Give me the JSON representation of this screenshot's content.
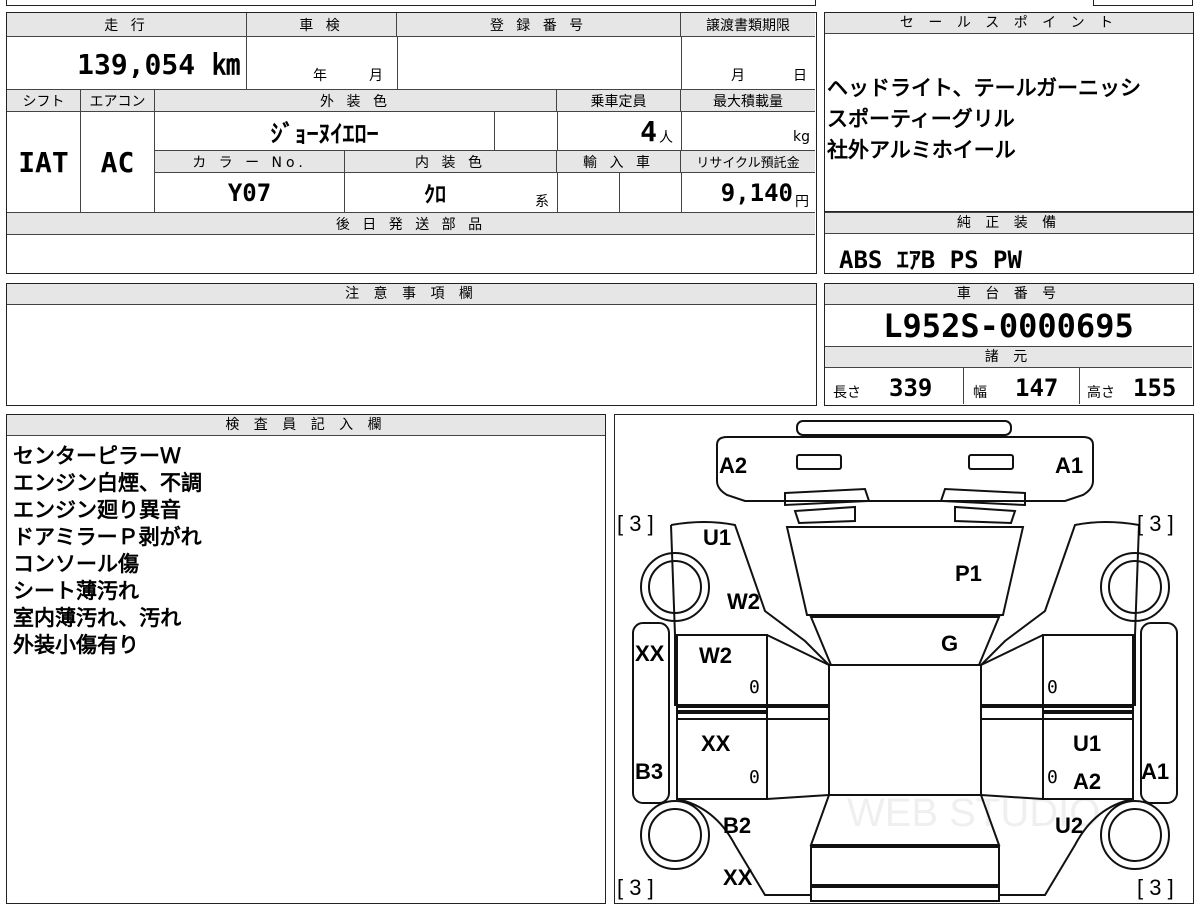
{
  "top": {
    "mileage_header": "走 行",
    "mileage": "139,054 ㎞",
    "inspection_header": "車 検",
    "inspection_year": "年",
    "inspection_month": "月",
    "reg_header": "登 録 番 号",
    "deadline_header": "譲渡書類期限",
    "deadline_month": "月",
    "deadline_day": "日",
    "shift_header": "シフト",
    "shift": "IAT",
    "ac_header": "エアコン",
    "ac": "AC",
    "ext_color_header": "外 装 色",
    "ext_color": "ｼﾞｮｰﾇｲｴﾛｰ",
    "capacity_header": "乗車定員",
    "capacity": "4",
    "capacity_unit": "人",
    "load_header": "最大積載量",
    "load_unit": "kg",
    "color_no_header": "カ ラ ー No.",
    "color_no": "Y07",
    "int_color_header": "内 装 色",
    "int_color": "ｸﾛ",
    "int_color_suffix": "系",
    "import_header": "輸 入 車",
    "recycle_header": "リサイクル預託金",
    "recycle": "9,140",
    "recycle_unit": "円",
    "later_parts_header": "後 日 発 送 部 品"
  },
  "sales_point": {
    "header": "セ ー ル ス ポ イ ン ト",
    "lines": [
      "ヘッドライト、テールガーニッシ",
      "スポーティーグリル",
      "社外アルミホイール"
    ]
  },
  "equipment": {
    "header": "純 正 装 備",
    "value": "ABS ｴｱB PS PW"
  },
  "notes": {
    "header": "注 意 事 項 欄"
  },
  "chassis": {
    "header": "車 台 番 号",
    "value": "L952S-0000695",
    "spec_header": "諸 元",
    "length_label": "長さ",
    "length": "339",
    "width_label": "幅",
    "width": "147",
    "height_label": "高さ",
    "height": "155"
  },
  "inspector": {
    "header": "検 査 員 記 入 欄",
    "lines": [
      "センターピラーＷ",
      "エンジン白煙、不調",
      "エンジン廻り異音",
      "ドアミラーＰ剥がれ",
      "コンソール傷",
      "シート薄汚れ",
      "室内薄汚れ、汚れ",
      "外装小傷有り"
    ]
  },
  "diagram": {
    "labels": {
      "a2_top": "A2",
      "a1_top": "A1",
      "tire_fl": "[ 3 ]",
      "tire_fr": "[ 3 ]",
      "u1_left": "U1",
      "p1": "P1",
      "w2_upper": "W2",
      "g": "G",
      "xx_left": "XX",
      "w2_door": "W2",
      "xx_door": "XX",
      "b3": "B3",
      "u1_right": "U1",
      "a2_right": "A2",
      "a1_right": "A1",
      "b2": "B2",
      "u2": "U2",
      "xx_bottom": "XX",
      "tire_rl": "[ 3 ]",
      "tire_rr": "[ 3 ]"
    },
    "zeros": [
      "0",
      "0",
      "0",
      "0"
    ],
    "watermark": "WEB STUDIO"
  }
}
